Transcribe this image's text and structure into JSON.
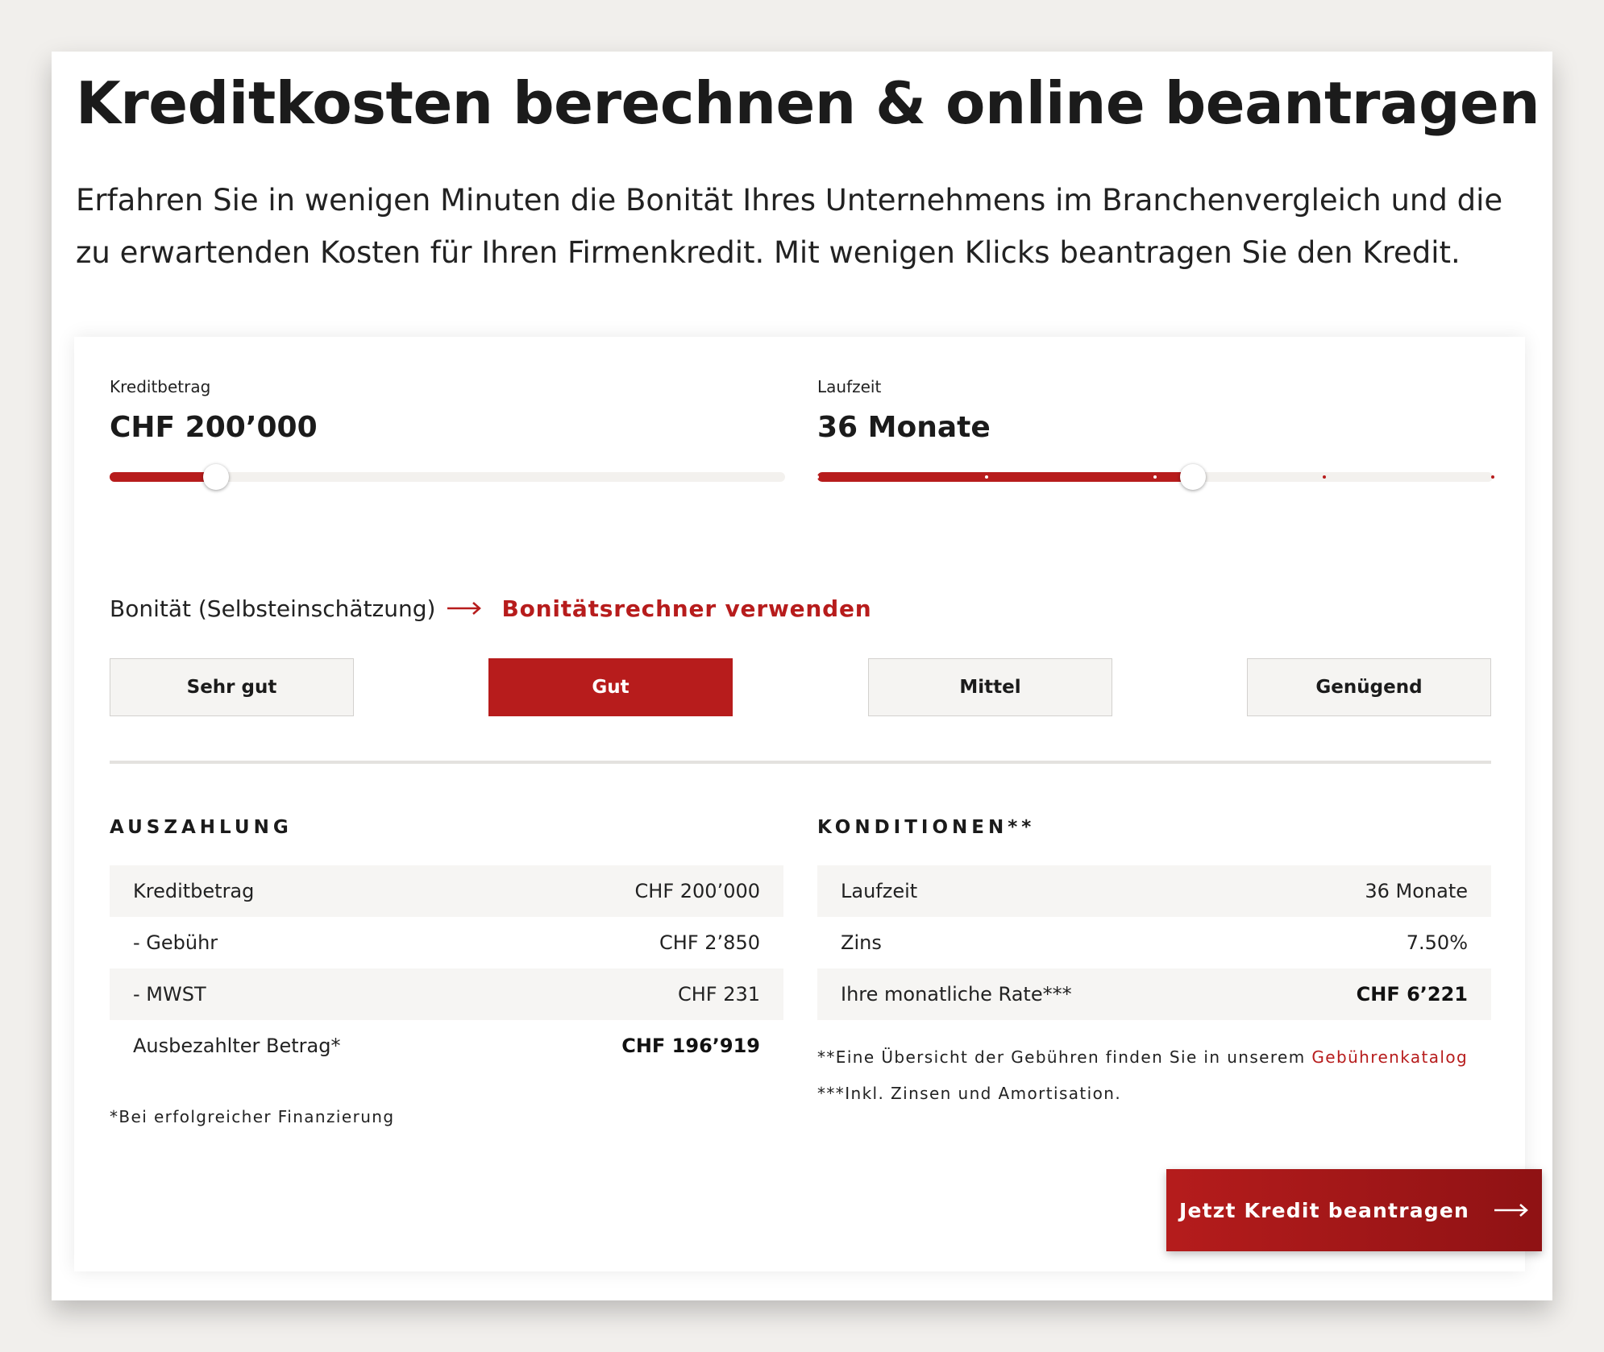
{
  "page": {
    "title": "Kreditkosten berechnen & online beantragen",
    "intro": "Erfahren Sie in wenigen Minuten die Bonität Ihres Unternehmens im Branchenvergleich und die zu erwartenden Kosten für Ihren Firmenkredit. Mit wenigen Klicks beantragen Sie den Kredit."
  },
  "calculator": {
    "amount": {
      "label": "Kreditbetrag",
      "value": "CHF 200’000",
      "level_fraction": 0.157
    },
    "term": {
      "label": "Laufzeit",
      "value": "36 Monate",
      "level_fraction": 0.556,
      "tick_count": 5
    },
    "rating": {
      "label": "Bonität (Selbsteinschätzung)",
      "link": "Bonitätsrechner verwenden",
      "arrow_icon": "long-right-arrow-icon",
      "options": [
        "Sehr gut",
        "Gut",
        "Mittel",
        "Genügend"
      ],
      "selected": "Gut"
    }
  },
  "auszahlung": {
    "heading": "AUSZAHLUNG",
    "rows": [
      {
        "label": "Kreditbetrag",
        "value": "CHF 200’000"
      },
      {
        "label": "- Gebühr",
        "value": "CHF 2’850"
      },
      {
        "label": "- MWST",
        "value": "CHF 231"
      },
      {
        "label": "Ausbezahlter Betrag*",
        "value": "CHF 196’919"
      }
    ],
    "footnote": "*Bei erfolgreicher Finanzierung"
  },
  "konditionen": {
    "heading": "KONDITIONEN**",
    "rows": [
      {
        "label": "Laufzeit",
        "value": "36 Monate"
      },
      {
        "label": "Zins",
        "value": "7.50%"
      },
      {
        "label": "Ihre monatliche Rate***",
        "value": "CHF 6’221"
      }
    ],
    "footnote1_text": "**Eine Übersicht der Gebühren finden Sie in unserem ",
    "footnote1_link": "Gebührenkatalog",
    "footnote2": "***Inkl. Zinsen und Amortisation."
  },
  "cta": {
    "label": "Jetzt Kredit beantragen",
    "arrow_icon": "long-right-arrow-icon"
  },
  "colors": {
    "accent": "#b71c1c",
    "background": "#f1efec",
    "track": "#f3f1ee"
  }
}
